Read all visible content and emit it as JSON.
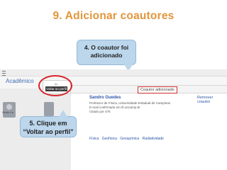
{
  "page": {
    "title": "9. Adicionar coautores"
  },
  "callouts": {
    "step4": "4. O coautor foi adicionado",
    "step5": "5. Clique em “Voltar ao perfil”"
  },
  "app": {
    "site_name": "Acadêmico"
  },
  "dropdown": {
    "indicator": "ds",
    "back_label": "Voltar ao perfil"
  },
  "profile": {
    "added_badge": "Coautor adicionado",
    "name": "Sandro Guedes",
    "remove_link": "Remover coautor",
    "line1": "Professor de Física, Universidade Estadual de Campinas",
    "line2": "E-mail confirmado em ifi.unicamp.br",
    "line3": "Citado por 475",
    "tags": [
      "Física",
      "Geofísica",
      "Geoquímica",
      "Radiatividade"
    ],
    "mini_name": "Sibila Ca"
  },
  "colors": {
    "title": "#e2953b",
    "callout_bg": "#bcd6ec",
    "highlight": "#d7262b",
    "link": "#2a56a8"
  }
}
